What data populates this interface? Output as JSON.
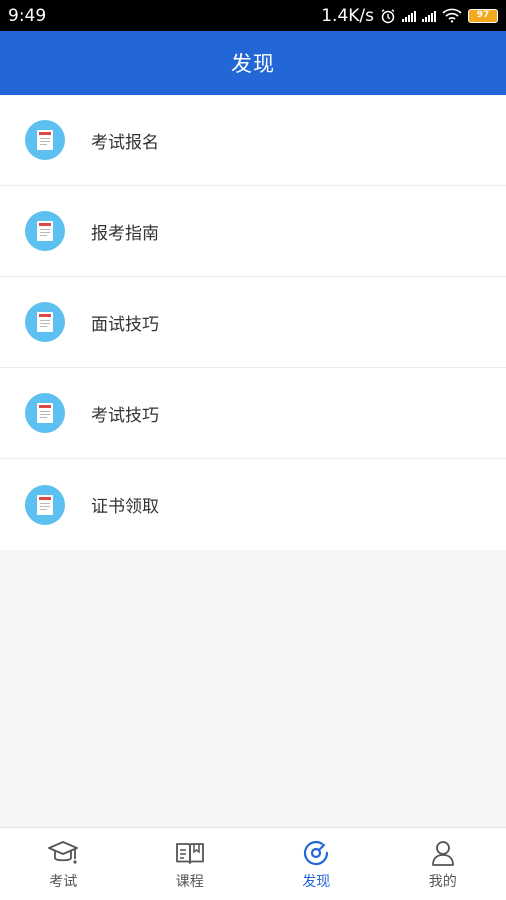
{
  "status_bar": {
    "time": "9:49",
    "net_speed": "1.4K/s",
    "battery": "97"
  },
  "header": {
    "title": "发现"
  },
  "list": {
    "items": [
      {
        "label": "考试报名",
        "icon": "document-icon"
      },
      {
        "label": "报考指南",
        "icon": "document-icon"
      },
      {
        "label": "面试技巧",
        "icon": "document-icon"
      },
      {
        "label": "考试技巧",
        "icon": "document-icon"
      },
      {
        "label": "证书领取",
        "icon": "document-icon"
      }
    ]
  },
  "tab_bar": {
    "tabs": [
      {
        "label": "考试",
        "icon": "graduation-cap-icon",
        "active": false
      },
      {
        "label": "课程",
        "icon": "open-book-icon",
        "active": false
      },
      {
        "label": "发现",
        "icon": "compass-icon",
        "active": true
      },
      {
        "label": "我的",
        "icon": "person-icon",
        "active": false
      }
    ]
  },
  "colors": {
    "primary": "#2367d6",
    "icon_circle": "#5cc0f0",
    "background": "#f4f5f7"
  }
}
